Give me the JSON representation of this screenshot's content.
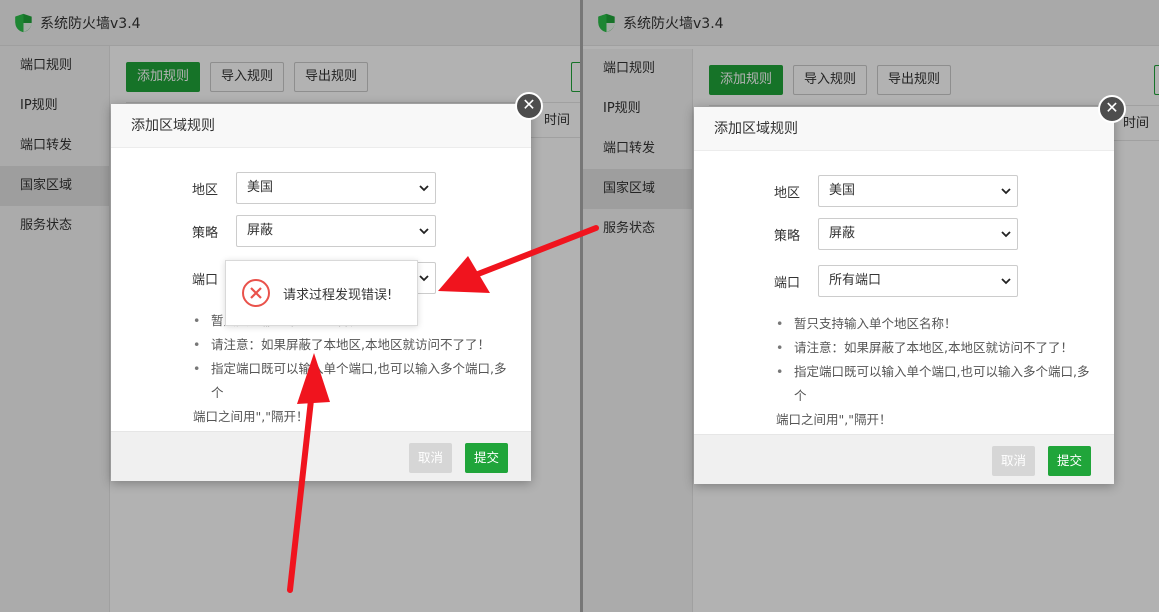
{
  "app": {
    "title": "系统防火墙v3.4"
  },
  "sidebar": {
    "items": [
      {
        "label": "端口规则"
      },
      {
        "label": "IP规则"
      },
      {
        "label": "端口转发"
      },
      {
        "label": "国家区域"
      },
      {
        "label": "服务状态"
      }
    ]
  },
  "toolbar": {
    "add_label": "添加规则",
    "import_label": "导入规则",
    "export_label": "导出规则"
  },
  "table": {
    "time_header": "时间"
  },
  "dialog": {
    "title": "添加区域规则",
    "region_label": "地区",
    "region_value": "美国",
    "policy_label": "策略",
    "policy_value": "屏蔽",
    "port_label": "端口",
    "port_value": "所有端口",
    "notes": [
      "暂只支持输入单个地区名称！",
      "请注意：如果屏蔽了本地区,本地区就访问不了了！",
      "指定端口既可以输入单个端口,也可以输入多个端口,多个"
    ],
    "notes_continuation": "端口之间用\",\"隔开！",
    "left_notes": [
      "暂只支持输入单个地区名称！",
      "请注意：如果屏蔽了本地区,本地区就访问不了了！",
      "指定端口既可以输入单个端口,也可以输入多个端口,多个"
    ],
    "cancel_label": "取消",
    "submit_label": "提交",
    "close_glyph": "✕"
  },
  "toast": {
    "message": "请求过程发现错误!"
  },
  "colors": {
    "accent": "#20a53a",
    "error": "#e9524b",
    "annotation": "#f0141e"
  }
}
